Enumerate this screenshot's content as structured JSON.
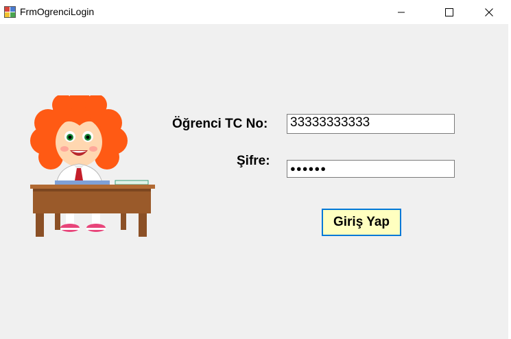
{
  "window": {
    "title": "FrmOgrenciLogin",
    "controls": [
      "minimize-icon",
      "maximize-icon",
      "close-icon"
    ]
  },
  "form": {
    "student_id_label": "Öğrenci TC No:",
    "student_id_value": "33333333333",
    "password_label": "Şifre:",
    "password_mask": "●●●●●●",
    "login_button": "Giriş Yap"
  },
  "colors": {
    "client_background": "#f0f0f0",
    "button_background": "#ffffc0",
    "button_border": "#0078d7"
  },
  "image": {
    "icon": "student-at-desk-illustration"
  }
}
